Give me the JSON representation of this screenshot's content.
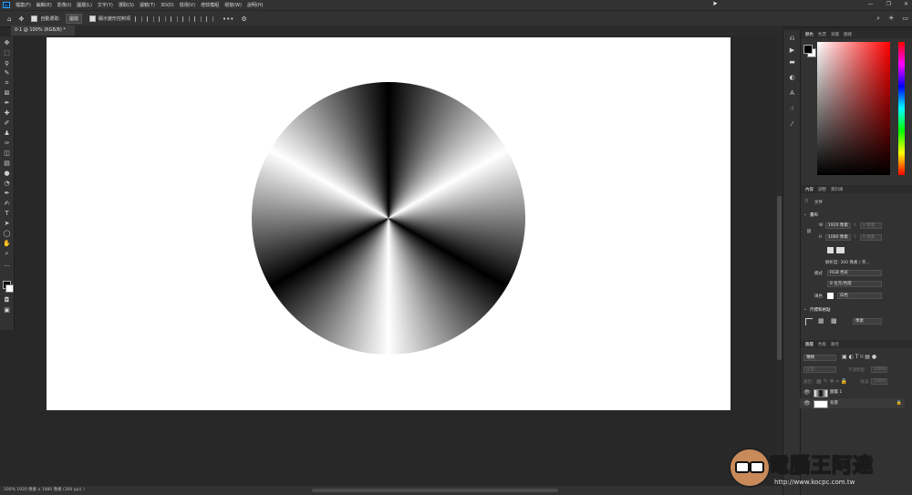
{
  "menubar": {
    "logo": "Ps",
    "items": [
      "檔案(F)",
      "編輯(E)",
      "影像(I)",
      "圖層(L)",
      "文字(Y)",
      "選取(S)",
      "濾鏡(T)",
      "3D(D)",
      "檢視(V)",
      "增效模組",
      "視窗(W)",
      "說明(H)"
    ],
    "window_controls": [
      "—",
      "❐",
      "✕"
    ]
  },
  "options": {
    "auto_select_label": "自動選取:",
    "auto_select_value": "圖層",
    "transform_label": "顯示變形控制項",
    "more": "•••"
  },
  "document": {
    "tab_title": "0-1 @ 100% (RGB/8) *",
    "status_text": "100%        1920 像素 x 1080 像素 (300 ppi)  〉"
  },
  "panels": {
    "color_tabs": [
      "顏色",
      "色票",
      "漸層",
      "圖樣"
    ],
    "properties_tabs": [
      "內容",
      "調整",
      "資料庫"
    ],
    "document_label": "文件",
    "canvas_section": "畫布",
    "width_label": "W",
    "width_value": "1920 像素",
    "height_label": "H",
    "height_value": "1080 像素",
    "x_label": "X",
    "x_value": "0 像素",
    "y_label": "Y",
    "y_value": "0 像素",
    "resolution": "解析度: 300 像素 / 英...",
    "mode_label": "模式",
    "mode_value": "RGB 色彩",
    "depth_value": "8 位元/色版",
    "fill_label": "填色",
    "fill_value": "白色",
    "rulers_section": "尺標和格點",
    "units_value": "像素",
    "layers_tabs": [
      "圖層",
      "色版",
      "路徑"
    ],
    "kind_value": "種類",
    "blend_value": "正常",
    "opacity_label": "不透明度:",
    "opacity_value": "100%",
    "lock_label": "鎖定:",
    "fill_pct_label": "填滿:",
    "fill_pct_value": "100%",
    "layers": [
      {
        "name": "圖層 1"
      },
      {
        "name": "背景"
      }
    ]
  },
  "watermark": {
    "text": "電腦王阿達",
    "url": "http://www.kocpc.com.tw"
  },
  "colors": {
    "ui_bg": "#282828",
    "panel_bg": "#323232",
    "canvas": "#ffffff"
  }
}
